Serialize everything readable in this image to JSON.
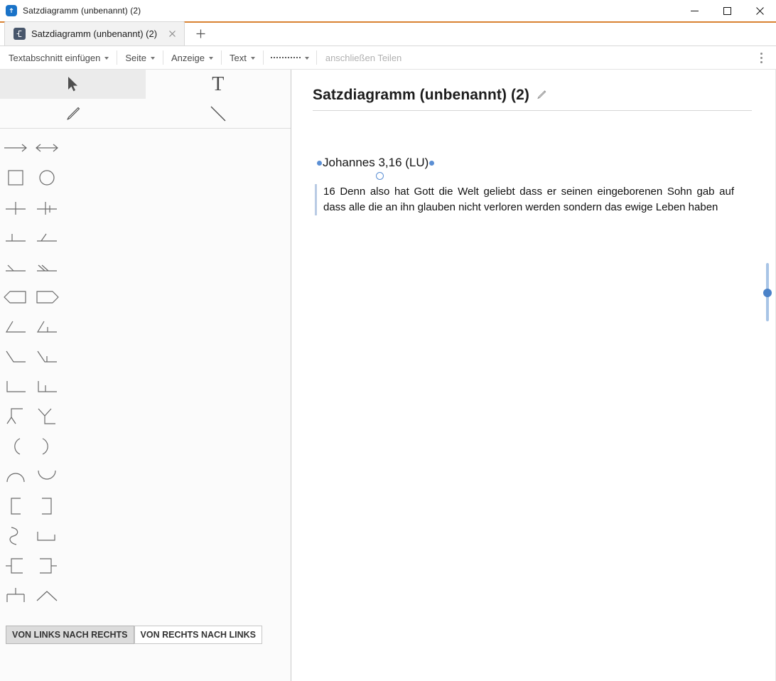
{
  "window": {
    "title": "Satzdiagramm (unbenannt) (2)",
    "app_icon": "app-logo-icon",
    "minimize_label": "Minimieren",
    "maximize_label": "Maximieren",
    "close_label": "Schließen"
  },
  "tabs": {
    "items": [
      {
        "title": "Satzdiagramm (unbenannt) (2)",
        "active": true,
        "favicon": "diagram-icon"
      }
    ],
    "new_tab_label": "+"
  },
  "toolbar": {
    "items": [
      {
        "label": "Textabschnitt einfügen",
        "has_caret": true,
        "name": "insert-text-section"
      },
      {
        "label": "Seite",
        "has_caret": true,
        "name": "page"
      },
      {
        "label": "Anzeige",
        "has_caret": true,
        "name": "display"
      },
      {
        "label": "Text",
        "has_caret": true,
        "name": "text"
      }
    ],
    "line_style": {
      "name": "line-style-dropdown",
      "style": "dotted"
    },
    "placeholder_text": "anschließen Teilen",
    "overflow_label": "Weitere Optionen"
  },
  "palette": {
    "tools": [
      {
        "name": "select-tool",
        "icon": "cursor-arrow-icon",
        "active": true
      },
      {
        "name": "text-tool",
        "icon": "text-T-icon",
        "active": false
      },
      {
        "name": "pencil-tool",
        "icon": "pencil-icon",
        "active": false
      },
      {
        "name": "line-tool",
        "icon": "diagonal-line-icon",
        "active": false
      }
    ],
    "shapes": [
      {
        "name": "arrow-right-shape",
        "icon": "arrow-right-icon"
      },
      {
        "name": "arrow-double-shape",
        "icon": "arrow-left-right-icon"
      },
      {
        "name": "rectangle-shape",
        "icon": "square-icon"
      },
      {
        "name": "ellipse-shape",
        "icon": "circle-icon"
      },
      {
        "name": "cross-shape",
        "icon": "plus-cross-icon"
      },
      {
        "name": "cross-tick-shape",
        "icon": "cross-with-tick-icon"
      },
      {
        "name": "perpendicular-shape",
        "icon": "t-perpendicular-icon"
      },
      {
        "name": "slant-on-line-shape",
        "icon": "slant-on-line-icon"
      },
      {
        "name": "single-slant-shape",
        "icon": "single-slant-line-icon"
      },
      {
        "name": "double-slant-shape",
        "icon": "double-slant-line-icon"
      },
      {
        "name": "left-pennant-shape",
        "icon": "left-pennant-icon"
      },
      {
        "name": "right-pennant-shape",
        "icon": "right-pennant-icon"
      },
      {
        "name": "slant-baseline-shape",
        "icon": "slant-baseline-icon"
      },
      {
        "name": "slant-baseline-tick-shape",
        "icon": "slant-baseline-tick-icon"
      },
      {
        "name": "steep-slant-shape",
        "icon": "steep-slant-baseline-icon"
      },
      {
        "name": "steep-slant-tick-shape",
        "icon": "steep-slant-tick-icon"
      },
      {
        "name": "corner-left-shape",
        "icon": "corner-left-icon"
      },
      {
        "name": "corner-left-tick-shape",
        "icon": "corner-left-tick-icon"
      },
      {
        "name": "branch-up-shape",
        "icon": "branch-up-icon"
      },
      {
        "name": "branch-fork-shape",
        "icon": "branch-fork-icon"
      },
      {
        "name": "arc-left-shape",
        "icon": "arc-left-icon"
      },
      {
        "name": "arc-right-shape",
        "icon": "arc-right-icon"
      },
      {
        "name": "arc-top-shape",
        "icon": "arc-top-icon"
      },
      {
        "name": "arc-bottom-shape",
        "icon": "arc-bottom-icon"
      },
      {
        "name": "bracket-left-shape",
        "icon": "bracket-left-icon"
      },
      {
        "name": "bracket-right-shape",
        "icon": "bracket-right-icon"
      },
      {
        "name": "s-curve-shape",
        "icon": "s-curve-icon"
      },
      {
        "name": "step-corner-shape",
        "icon": "step-corner-icon"
      },
      {
        "name": "bracket-left-stem-shape",
        "icon": "bracket-left-stem-icon"
      },
      {
        "name": "bracket-right-stem-shape",
        "icon": "bracket-right-stem-icon"
      },
      {
        "name": "tee-down-shape",
        "icon": "tee-down-icon"
      },
      {
        "name": "chevron-up-shape",
        "icon": "chevron-up-icon"
      }
    ],
    "direction_buttons": [
      {
        "label": "VON LINKS NACH RECHTS",
        "selected": true,
        "name": "ltr-direction-button"
      },
      {
        "label": "VON RECHTS NACH LINKS",
        "selected": false,
        "name": "rtl-direction-button"
      }
    ]
  },
  "document": {
    "title": "Satzdiagramm (unbenannt) (2)",
    "edit_icon": "pencil-edit-icon",
    "verse_reference": "Johannes 3,16 (LU)",
    "verse_text": "16 Denn also hat Gott die Welt geliebt dass er seinen eingeborenen Sohn gab auf dass alle die an ihn glauben nicht verloren werden sondern das ewige Leben haben"
  },
  "colors": {
    "accent_orange": "#d98232",
    "marker_blue": "#5b8fd4",
    "quote_bar": "#b9cbe4",
    "slider_blue": "#4a82c8",
    "tab_favicon_bg": "#48566b"
  }
}
